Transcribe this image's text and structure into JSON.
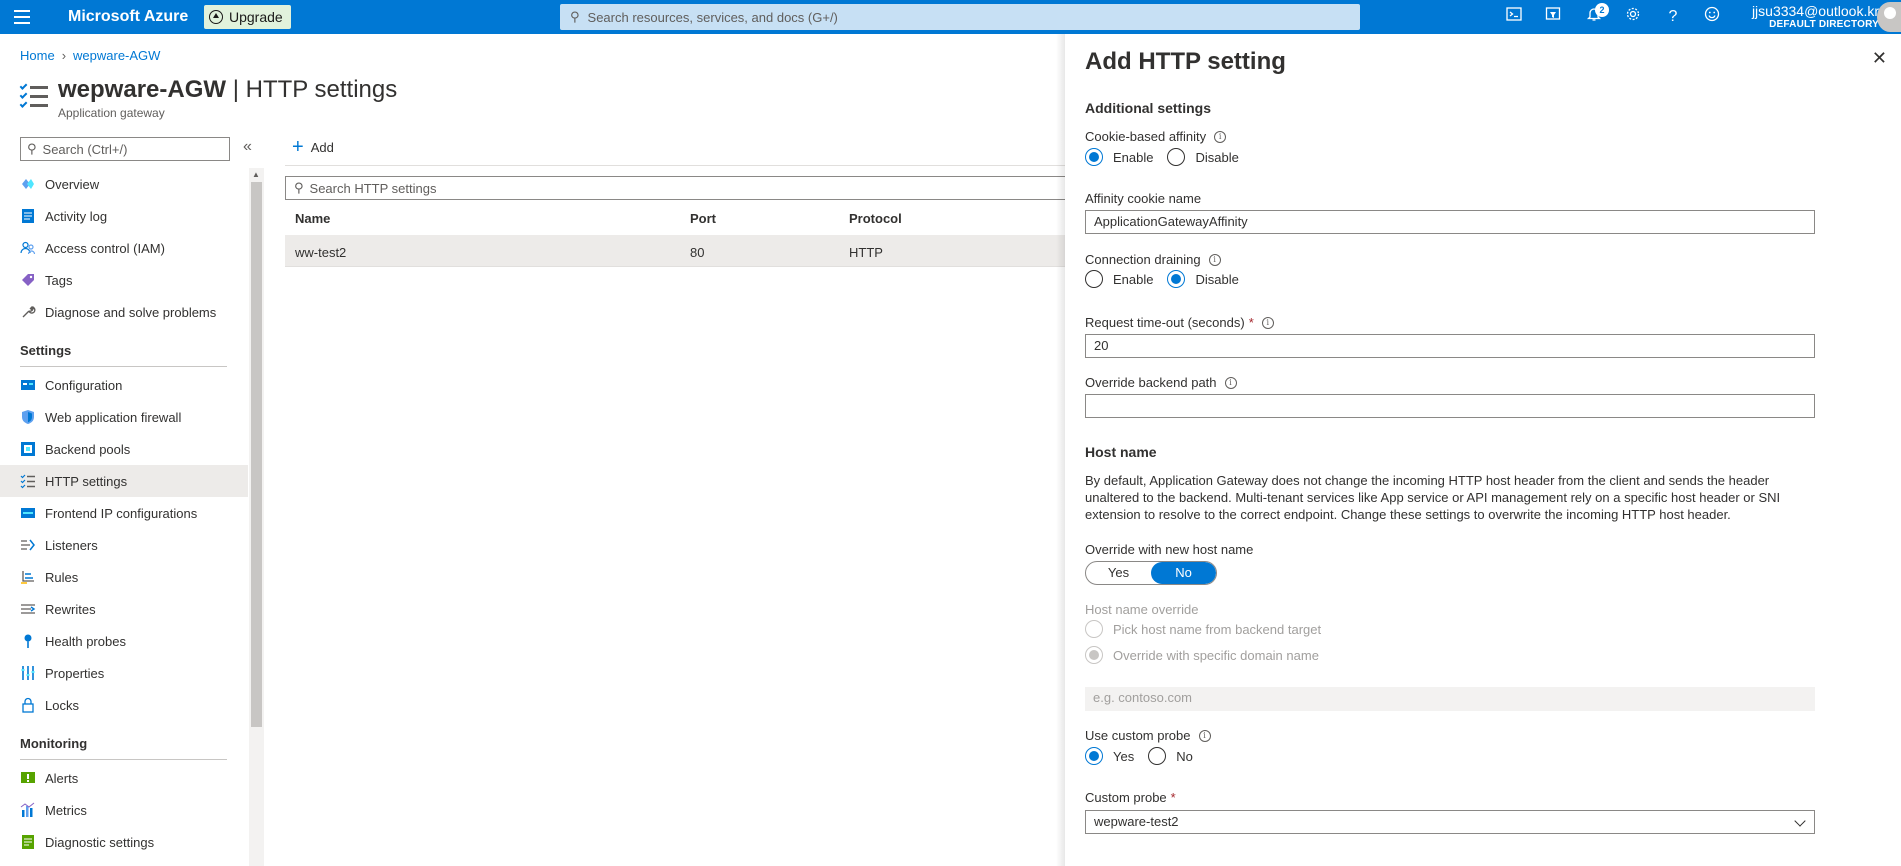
{
  "topbar": {
    "brand": "Microsoft Azure",
    "upgrade_label": "Upgrade",
    "search_placeholder": "Search resources, services, and docs (G+/)",
    "notifications_count": "2",
    "user_email": "jjsu3334@outlook.kr",
    "user_directory": "DEFAULT DIRECTORY"
  },
  "breadcrumb": {
    "home": "Home",
    "resource": "wepware-AGW"
  },
  "page": {
    "resource_name": "wepware-AGW",
    "section": "HTTP settings",
    "subtitle": "Application gateway"
  },
  "nav": {
    "search_placeholder": "Search (Ctrl+/)",
    "items_top": [
      "Overview",
      "Activity log",
      "Access control (IAM)",
      "Tags",
      "Diagnose and solve problems"
    ],
    "settings_header": "Settings",
    "items_settings": [
      "Configuration",
      "Web application firewall",
      "Backend pools",
      "HTTP settings",
      "Frontend IP configurations",
      "Listeners",
      "Rules",
      "Rewrites",
      "Health probes",
      "Properties",
      "Locks"
    ],
    "monitoring_header": "Monitoring",
    "items_monitoring": [
      "Alerts",
      "Metrics",
      "Diagnostic settings"
    ]
  },
  "main": {
    "add_label": "Add",
    "search_placeholder": "Search HTTP settings",
    "columns": [
      "Name",
      "Port",
      "Protocol"
    ],
    "rows": [
      {
        "name": "ww-test2",
        "port": "80",
        "protocol": "HTTP"
      }
    ]
  },
  "pane": {
    "title": "Add HTTP setting",
    "additional_settings": "Additional settings",
    "cookie_affinity_label": "Cookie-based affinity",
    "enable": "Enable",
    "disable": "Disable",
    "cookie_affinity_value": "Enable",
    "affinity_cookie_name_label": "Affinity cookie name",
    "affinity_cookie_name_value": "ApplicationGatewayAffinity",
    "connection_draining_label": "Connection draining",
    "connection_draining_value": "Disable",
    "request_timeout_label": "Request time-out (seconds)",
    "request_timeout_value": "20",
    "override_backend_path_label": "Override backend path",
    "override_backend_path_value": "",
    "host_name_title": "Host name",
    "host_name_description": "By default, Application Gateway does not change the incoming HTTP host header from the client and sends the header unaltered to the backend. Multi-tenant services like App service or API management rely on a specific host header or SNI extension to resolve to the correct endpoint. Change these settings to overwrite the incoming HTTP host header.",
    "override_host_label": "Override with new host name",
    "yes": "Yes",
    "no": "No",
    "override_host_value": "No",
    "host_name_override_label": "Host name override",
    "pick_host_option": "Pick host name from backend target",
    "override_domain_option": "Override with specific domain name",
    "domain_placeholder": "e.g. contoso.com",
    "use_custom_probe_label": "Use custom probe",
    "use_custom_probe_value": "Yes",
    "custom_probe_label": "Custom probe",
    "custom_probe_value": "wepware-test2"
  },
  "colors": {
    "accent": "#0078d4",
    "topbar": "#0078d4",
    "upgrade_bg": "#e1f2dc",
    "selected_row": "#edebe9"
  }
}
